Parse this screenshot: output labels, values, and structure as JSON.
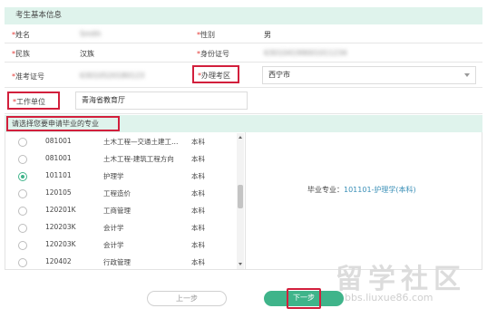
{
  "basic_info": {
    "section_title": "考生基本信息",
    "fields": {
      "name_label": "姓名",
      "name_value": "Smith",
      "gender_label": "性别",
      "gender_value": "男",
      "ethnicity_label": "民族",
      "ethnicity_value": "汉族",
      "id_label": "身份证号",
      "id_value": "630104199001011234",
      "exam_id_label": "准考证号",
      "exam_id_value": "63010520180123",
      "exam_area_label": "办理考区",
      "exam_area_value": "西宁市",
      "workplace_label": "工作单位",
      "workplace_value": "青海省教育厅"
    },
    "required_mark": "*"
  },
  "major_section": {
    "title": "请选择您要申请毕业的专业",
    "majors": [
      {
        "code": "081001",
        "name": "土木工程—交通土建工…",
        "level": "本科",
        "selected": false
      },
      {
        "code": "081001",
        "name": "土木工程-建筑工程方向",
        "level": "本科",
        "selected": false
      },
      {
        "code": "101101",
        "name": "护理学",
        "level": "本科",
        "selected": true
      },
      {
        "code": "120105",
        "name": "工程造价",
        "level": "本科",
        "selected": false
      },
      {
        "code": "120201K",
        "name": "工商管理",
        "level": "本科",
        "selected": false
      },
      {
        "code": "120203K",
        "name": "会计学",
        "level": "本科",
        "selected": false
      },
      {
        "code": "120203K",
        "name": "会计学",
        "level": "本科",
        "selected": false
      },
      {
        "code": "120402",
        "name": "行政管理",
        "level": "本科",
        "selected": false
      }
    ],
    "graduation_major_label": "毕业专业：",
    "graduation_major_value": "101101-护理学(本科)"
  },
  "buttons": {
    "prev": "上一步",
    "next": "下一步"
  },
  "watermark": {
    "main": "留学社区",
    "url": "bbs.liuxue86.com"
  },
  "colors": {
    "section_bg": "#dff3ec",
    "accent": "#3fb48a",
    "highlight": "#d21f3c"
  }
}
